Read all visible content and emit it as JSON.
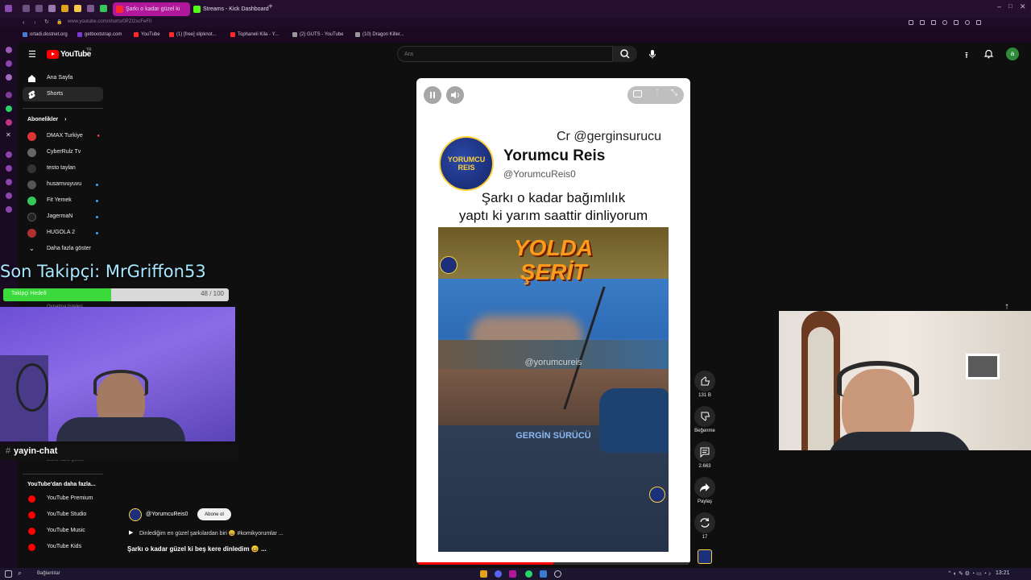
{
  "browser": {
    "tabs": [
      {
        "label": "Şarkı o kadar güzel ki",
        "active": true
      },
      {
        "label": "Streams - Kick Dashboard",
        "active": false
      }
    ],
    "url": "www.youtube.com/shorts/0PZI2scFeF0",
    "bookmarks": [
      "ortadi.dostnet.org",
      "getbootstrap.com",
      "YouTube",
      "(1) [free] slipknot...",
      "Tophaneli Kila - Y...",
      "(2) GUTS - YouTube",
      "(10) Dragon Killer..."
    ]
  },
  "youtube": {
    "logo": "YouTube",
    "logo_sup": "TR",
    "search_placeholder": "Ara",
    "avatar_letter": "a",
    "nav": {
      "home": "Ana Sayfa",
      "shorts": "Shorts"
    },
    "subs_title": "Abonelikler",
    "subscriptions": [
      {
        "name": "DMAX Turkiye",
        "live": true,
        "color": "#e03434"
      },
      {
        "name": "CyberRulz Tv",
        "live": false,
        "color": "#666666"
      },
      {
        "name": "testo taylan",
        "live": false,
        "color": "#333333"
      },
      {
        "name": "husamvuyuvu",
        "live": false,
        "color": "#555555"
      },
      {
        "name": "Fit Yemek",
        "live": false,
        "color": "#35c759"
      },
      {
        "name": "JagermaN",
        "live": false,
        "color": "#222222"
      },
      {
        "name": "HUGOLA 2",
        "live": false,
        "color": "#b03030"
      }
    ],
    "show_more": "Daha fazla göster",
    "more_title": "YouTube'dan daha fazla...",
    "more_items": [
      "YouTube Premium",
      "YouTube Studio",
      "YouTube Music",
      "YouTube Kids"
    ],
    "hidden_items": [
      "Oynatma listeleri",
      "Daha fazla göster"
    ]
  },
  "short": {
    "credit": "Cr @gerginsurucu",
    "channel_name": "Yorumcu Reis",
    "channel_handle": "@YorumcuReis0",
    "channel_badge": "YORUMCU REIS",
    "caption_line1": "Şarkı o kadar bağımlılık",
    "caption_line2": "yaptı ki yarım saattir dinliyorum",
    "video_title1": "YOLDA",
    "video_title2": "ŞERİT",
    "watermark": "@yorumcureis",
    "sub_watermark": "GERGİN SÜRÜCÜ",
    "author": "@YorumcuReis0",
    "subscribe": "Abone ol",
    "desc": "Dinlediğim en güzel şarkılardan biri 😄 #komikyorumlar ...",
    "title": "Şarkı o kadar güzel ki beş kere dinledim 😄 ..."
  },
  "actions": {
    "likes": "131 B",
    "dislike": "Beğenme",
    "comments": "2.663",
    "share": "Paylaş",
    "remix": "17"
  },
  "overlay": {
    "last_follower": "Son Takipçi: MrGriffon53",
    "goal_label": "Takipçi Hedefi",
    "goal_count": "48 / 100",
    "goal_progress": 0.48,
    "chat_channel": "yayin-chat"
  },
  "taskbar": {
    "search_label": "Bağlantılar",
    "time": "13:21"
  }
}
